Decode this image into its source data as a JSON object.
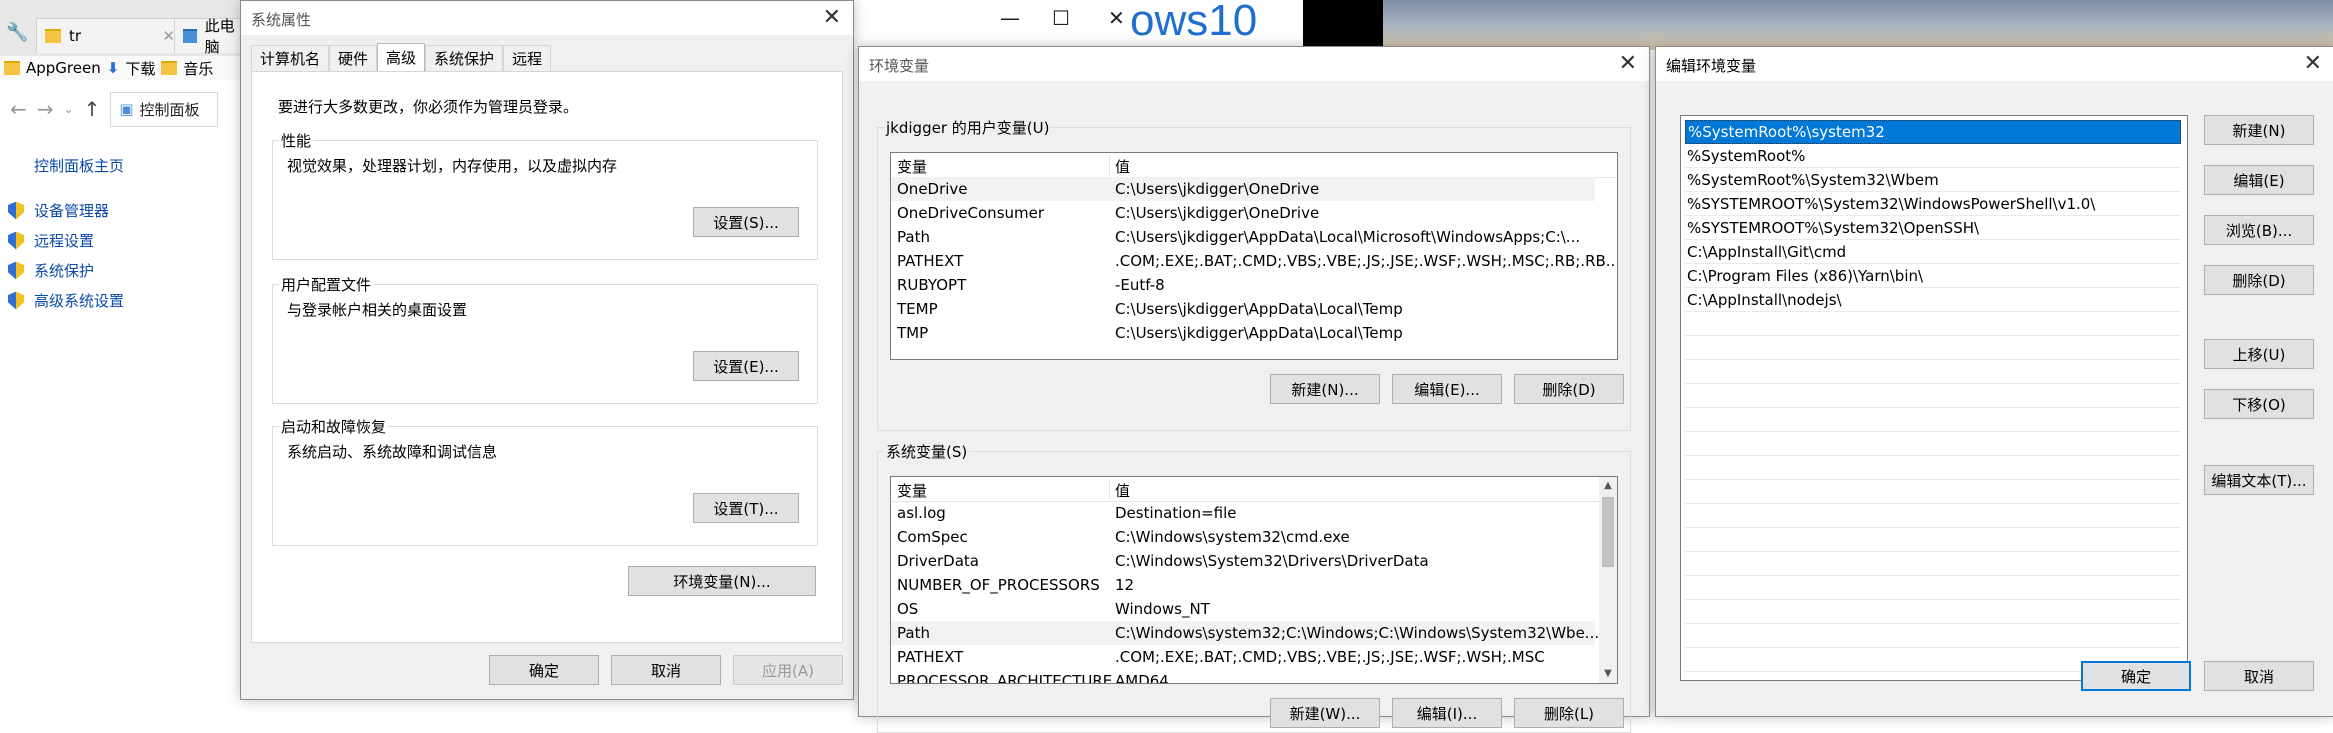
{
  "explorer": {
    "tabs": [
      {
        "label": "tr"
      },
      {
        "label": "此电脑"
      }
    ],
    "favorites": [
      "AppGreen",
      "下载",
      "音乐"
    ],
    "address": "控制面板",
    "home_link": "控制面板主页",
    "links": [
      "设备管理器",
      "远程设置",
      "系统保护",
      "高级系统设置"
    ]
  },
  "win10_banner": "ows10",
  "system_properties": {
    "title": "系统属性",
    "tabs": [
      "计算机名",
      "硬件",
      "高级",
      "系统保护",
      "远程"
    ],
    "active_tab": "高级",
    "admin_note": "要进行大多数更改，你必须作为管理员登录。",
    "performance": {
      "label": "性能",
      "desc": "视觉效果，处理器计划，内存使用，以及虚拟内存",
      "button": "设置(S)..."
    },
    "profiles": {
      "label": "用户配置文件",
      "desc": "与登录帐户相关的桌面设置",
      "button": "设置(E)..."
    },
    "startup": {
      "label": "启动和故障恢复",
      "desc": "系统启动、系统故障和调试信息",
      "button": "设置(T)..."
    },
    "env_button": "环境变量(N)...",
    "ok": "确定",
    "cancel": "取消",
    "apply": "应用(A)"
  },
  "env_vars": {
    "title": "环境变量",
    "user_group_label": "jkdigger 的用户变量(U)",
    "col_var": "变量",
    "col_val": "值",
    "user_vars": [
      {
        "name": "OneDrive",
        "value": "C:\\Users\\jkdigger\\OneDrive"
      },
      {
        "name": "OneDriveConsumer",
        "value": "C:\\Users\\jkdigger\\OneDrive"
      },
      {
        "name": "Path",
        "value": "C:\\Users\\jkdigger\\AppData\\Local\\Microsoft\\WindowsApps;C:\\..."
      },
      {
        "name": "PATHEXT",
        "value": ".COM;.EXE;.BAT;.CMD;.VBS;.VBE;.JS;.JSE;.WSF;.WSH;.MSC;.RB;.RB..."
      },
      {
        "name": "RUBYOPT",
        "value": "-Eutf-8"
      },
      {
        "name": "TEMP",
        "value": "C:\\Users\\jkdigger\\AppData\\Local\\Temp"
      },
      {
        "name": "TMP",
        "value": "C:\\Users\\jkdigger\\AppData\\Local\\Temp"
      }
    ],
    "user_buttons": {
      "new": "新建(N)...",
      "edit": "编辑(E)...",
      "delete": "删除(D)"
    },
    "system_group_label": "系统变量(S)",
    "system_vars": [
      {
        "name": "asl.log",
        "value": "Destination=file"
      },
      {
        "name": "ComSpec",
        "value": "C:\\Windows\\system32\\cmd.exe"
      },
      {
        "name": "DriverData",
        "value": "C:\\Windows\\System32\\Drivers\\DriverData"
      },
      {
        "name": "NUMBER_OF_PROCESSORS",
        "value": "12"
      },
      {
        "name": "OS",
        "value": "Windows_NT"
      },
      {
        "name": "Path",
        "value": "C:\\Windows\\system32;C:\\Windows;C:\\Windows\\System32\\Wbe..."
      },
      {
        "name": "PATHEXT",
        "value": ".COM;.EXE;.BAT;.CMD;.VBS;.VBE;.JS;.JSE;.WSF;.WSH;.MSC"
      },
      {
        "name": "PROCESSOR_ARCHITECTURE",
        "value": "AMD64"
      }
    ],
    "system_buttons": {
      "new": "新建(W)...",
      "edit": "编辑(I)...",
      "delete": "删除(L)"
    }
  },
  "edit_env": {
    "title": "编辑环境变量",
    "paths": [
      "%SystemRoot%\\system32",
      "%SystemRoot%",
      "%SystemRoot%\\System32\\Wbem",
      "%SYSTEMROOT%\\System32\\WindowsPowerShell\\v1.0\\",
      "%SYSTEMROOT%\\System32\\OpenSSH\\",
      "C:\\AppInstall\\Git\\cmd",
      "C:\\Program Files (x86)\\Yarn\\bin\\",
      "C:\\AppInstall\\nodejs\\"
    ],
    "buttons": {
      "new": "新建(N)",
      "edit": "编辑(E)",
      "browse": "浏览(B)...",
      "delete": "删除(D)",
      "up": "上移(U)",
      "down": "下移(O)",
      "edit_text": "编辑文本(T)..."
    },
    "ok": "确定",
    "cancel": "取消"
  }
}
